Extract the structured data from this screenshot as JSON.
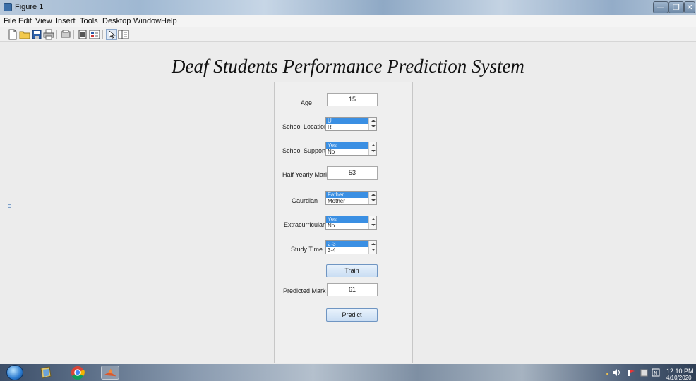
{
  "window": {
    "title": "Figure 1",
    "min_glyph": "—",
    "max_glyph": "❐",
    "close_glyph": "✕"
  },
  "menu": [
    "File",
    "Edit",
    "View",
    "Insert",
    "Tools",
    "Desktop",
    "Window",
    "Help"
  ],
  "toolbar_icons": [
    "new-figure-icon",
    "open-file-icon",
    "save-icon",
    "print-icon",
    "print-preview-icon",
    "link-plot-icon",
    "insert-legend-icon",
    "select-arrow-icon",
    "property-inspector-icon"
  ],
  "heading": "Deaf Students Performance Prediction System",
  "form": {
    "age": {
      "label": "Age",
      "value": "15"
    },
    "school_location": {
      "label": "School Location",
      "options": [
        "U",
        "R"
      ],
      "selected": 0
    },
    "school_support": {
      "label": "School Support",
      "options": [
        "Yes",
        "No"
      ],
      "selected": 0
    },
    "half_yearly": {
      "label": "Half Yearly Marks",
      "value": "53"
    },
    "guardian": {
      "label": "Gaurdian",
      "options": [
        "Father",
        "Mother"
      ],
      "selected": 0
    },
    "extracurricular": {
      "label": "Extracurricular",
      "options": [
        "Yes",
        "No"
      ],
      "selected": 0
    },
    "study_time": {
      "label": "Study Time",
      "options": [
        "2-3",
        "3-4"
      ],
      "selected": 0
    },
    "train_label": "Train",
    "predicted": {
      "label": "Predicted Mark",
      "value": "61"
    },
    "predict_label": "Predict"
  },
  "taskbar": {
    "apps": [
      "windows-explorer-icon",
      "chrome-icon",
      "matlab-icon"
    ],
    "clock": {
      "time": "12:10 PM",
      "date": "4/10/2020"
    }
  }
}
